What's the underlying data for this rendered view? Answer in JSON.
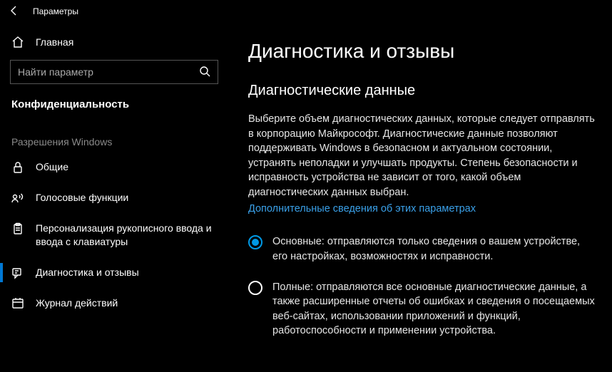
{
  "window": {
    "title": "Параметры"
  },
  "sidebar": {
    "home": "Главная",
    "search_placeholder": "Найти параметр",
    "category": "Конфиденциальность",
    "section": "Разрешения Windows",
    "items": [
      {
        "label": "Общие"
      },
      {
        "label": "Голосовые функции"
      },
      {
        "label": "Персонализация рукописного ввода и ввода с клавиатуры"
      },
      {
        "label": "Диагностика и отзывы"
      },
      {
        "label": "Журнал действий"
      }
    ]
  },
  "main": {
    "title": "Диагностика и отзывы",
    "subtitle": "Диагностические данные",
    "description": "Выберите объем диагностических данных, которые следует отправлять в корпорацию Майкрософт. Диагностические данные позволяют поддерживать Windows в безопасном и актуальном состоянии, устранять неполадки и улучшать продукты. Степень безопасности и исправность устройства не зависит от того, какой объем диагностических данных выбран.",
    "link": "Дополнительные сведения об этих параметрах",
    "options": [
      {
        "label": "Основные: отправляются только сведения о вашем устройстве, его настройках, возможностях и исправности.",
        "selected": true
      },
      {
        "label": "Полные: отправляются все основные диагностические данные, а также расширенные отчеты об ошибках и сведения о посещаемых веб-сайтах, использовании приложений и функций, работоспособности и применении устройства.",
        "selected": false
      }
    ]
  }
}
